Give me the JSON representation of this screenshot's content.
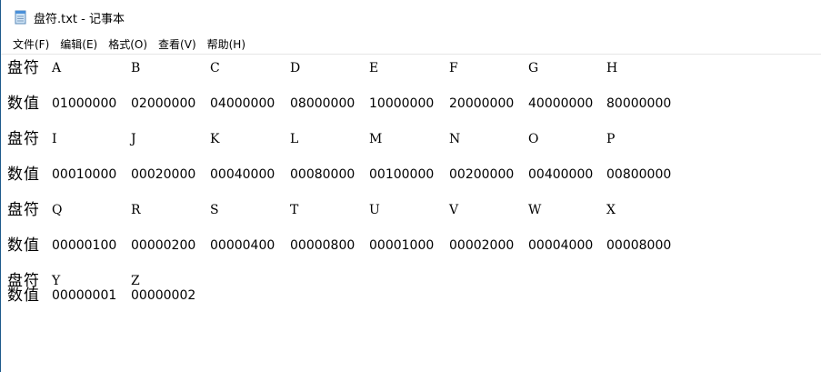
{
  "window": {
    "title": "盘符.txt - 记事本"
  },
  "menu": [
    {
      "label": "文件(F)"
    },
    {
      "label": "编辑(E)"
    },
    {
      "label": "格式(O)"
    },
    {
      "label": "查看(V)"
    },
    {
      "label": "帮助(H)"
    }
  ],
  "content": {
    "rows": [
      {
        "label": "盘符",
        "cells": [
          "A",
          "B",
          "C",
          "D",
          "E",
          "F",
          "G",
          "H"
        ]
      },
      {
        "label": "数值",
        "cells": [
          "01000000",
          "02000000",
          "04000000",
          "08000000",
          "10000000",
          "20000000",
          "40000000",
          "80000000"
        ]
      },
      {
        "label": "盘符",
        "cells": [
          "I",
          "J",
          "K",
          "L",
          "M",
          "N",
          "O",
          "P"
        ]
      },
      {
        "label": "数值",
        "cells": [
          "00010000",
          "00020000",
          "00040000",
          "00080000",
          "00100000",
          "00200000",
          "00400000",
          "00800000"
        ]
      },
      {
        "label": "盘符",
        "cells": [
          "Q",
          "R",
          "S",
          "T",
          "U",
          "V",
          "W",
          "X"
        ]
      },
      {
        "label": "数值",
        "cells": [
          "00000100",
          "00000200",
          "00000400",
          "00000800",
          "00001000",
          "00002000",
          "00004000",
          "00008000"
        ]
      },
      {
        "label": "盘符",
        "cells": [
          "Y",
          "Z"
        ]
      },
      {
        "label": "数值",
        "cells": [
          "00000001",
          "00000002"
        ]
      }
    ]
  },
  "colors": {
    "text": "#000000",
    "background": "#ffffff",
    "window_border": "#1e5a8c"
  },
  "icons": {
    "app": "notepad-icon"
  }
}
